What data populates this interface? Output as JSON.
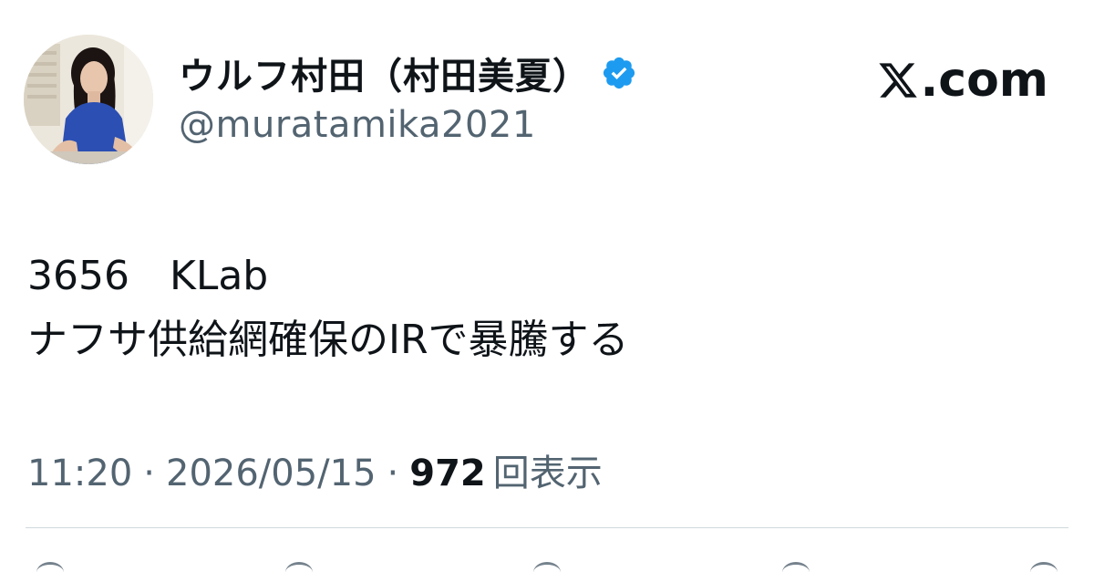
{
  "brand": {
    "label": ".com",
    "icon": "x-logo-icon"
  },
  "author": {
    "display_name": "ウルフ村田（村田美夏）",
    "handle": "@muratamika2021",
    "verified_icon": "verified-badge-icon",
    "avatar": "profile-photo"
  },
  "tweet": {
    "text": "3656　KLab\nナフサ供給網確保のIRで暴騰する"
  },
  "meta": {
    "time": "11:20",
    "sep1": "·",
    "date": "2026/05/15",
    "sep2": "·",
    "views_count": "972",
    "views_label": "回表示"
  },
  "colors": {
    "text": "#0f1419",
    "secondary": "#536471",
    "verified": "#1d9bf0",
    "divider": "#cfd9de"
  }
}
